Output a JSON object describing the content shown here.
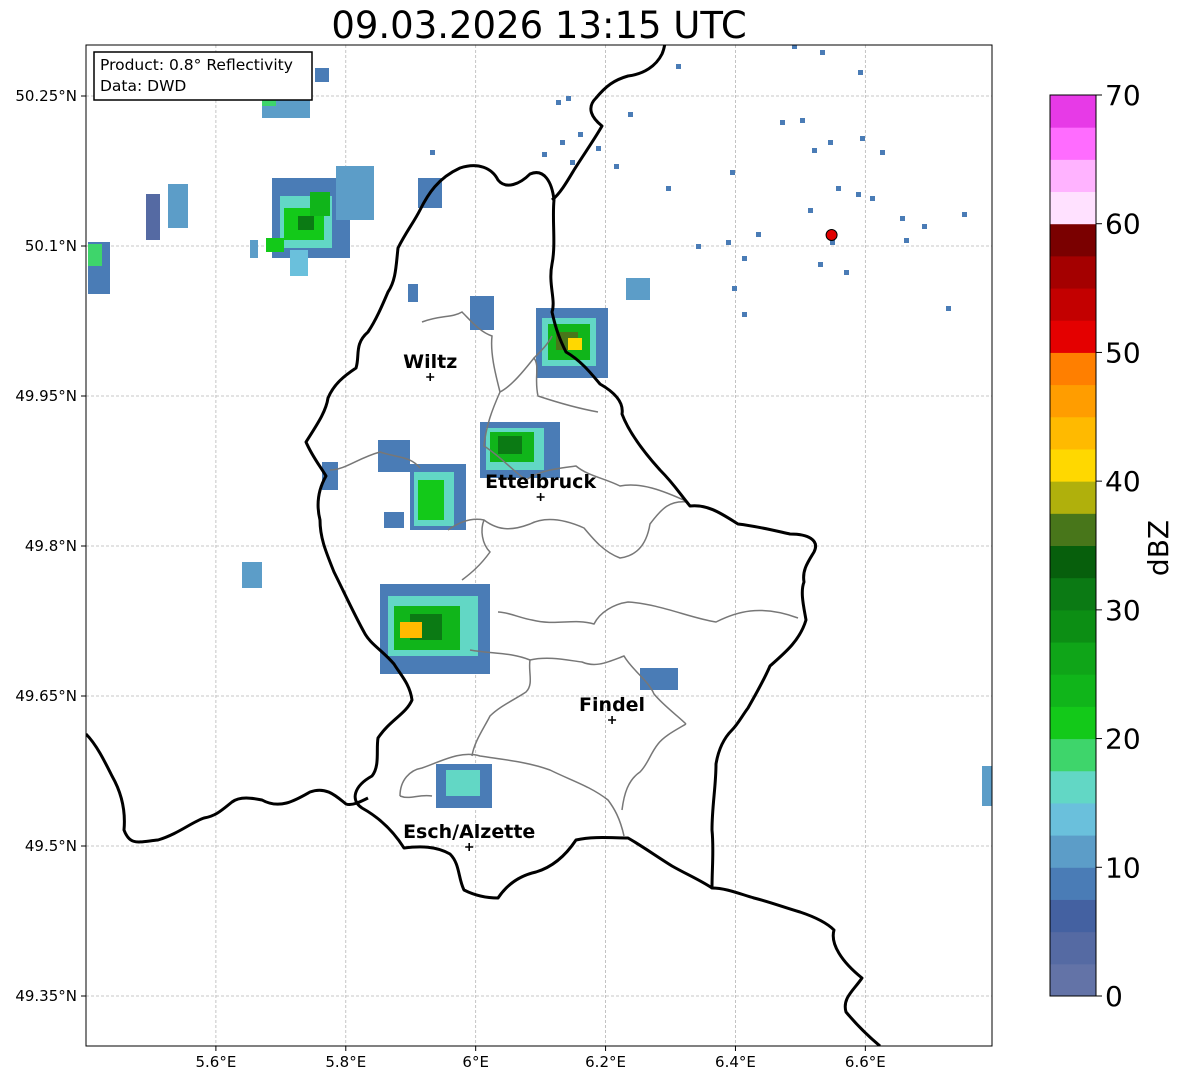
{
  "title": "09.03.2026 13:15 UTC",
  "info_box": {
    "line1": "Product: 0.8° Reflectivity",
    "line2": "Data: DWD"
  },
  "lat_labels": [
    {
      "text": "50.25°N",
      "lat": 50.25
    },
    {
      "text": "50.1°N",
      "lat": 50.1
    },
    {
      "text": "49.95°N",
      "lat": 49.95
    },
    {
      "text": "49.8°N",
      "lat": 49.8
    },
    {
      "text": "49.65°N",
      "lat": 49.65
    },
    {
      "text": "49.5°N",
      "lat": 49.5
    },
    {
      "text": "49.35°N",
      "lat": 49.35
    }
  ],
  "lon_labels": [
    {
      "text": "5.6°E",
      "lon": 5.6
    },
    {
      "text": "5.8°E",
      "lon": 5.8
    },
    {
      "text": "6°E",
      "lon": 6.0
    },
    {
      "text": "6.2°E",
      "lon": 6.2
    },
    {
      "text": "6.4°E",
      "lon": 6.4
    },
    {
      "text": "6.6°E",
      "lon": 6.6
    }
  ],
  "extent": {
    "lon_min": 5.4,
    "lon_max": 6.795,
    "lat_min": 49.3,
    "lat_max": 50.301
  },
  "cities": [
    {
      "name": "Wiltz",
      "lon": 5.93,
      "lat": 49.969
    },
    {
      "name": "Ettelbruck",
      "lon": 6.1,
      "lat": 49.849
    },
    {
      "name": "Findel",
      "lon": 6.21,
      "lat": 49.626
    },
    {
      "name": "Esch/Alzette",
      "lon": 5.99,
      "lat": 49.499
    }
  ],
  "radar_site": {
    "lon": 6.548,
    "lat": 50.111,
    "color": "#e00000"
  },
  "colorbar": {
    "label": "dBZ",
    "ticks": [
      "0",
      "10",
      "20",
      "30",
      "40",
      "50",
      "60",
      "70"
    ],
    "colors": [
      "#6373a7",
      "#556aa3",
      "#4461a1",
      "#4a7cb6",
      "#5c9dc8",
      "#6ac0dc",
      "#62d7c5",
      "#3ed56b",
      "#13c919",
      "#10b51a",
      "#0fa518",
      "#0c8e14",
      "#0b7a14",
      "#075f0c",
      "#48761a",
      "#b0b00c",
      "#ffd800",
      "#ffba00",
      "#ff9d00",
      "#ff7f00",
      "#e40000",
      "#c30000",
      "#a40000",
      "#7a0000",
      "#ffe1ff",
      "#ffb3ff",
      "#ff6cff",
      "#e73ae7"
    ]
  },
  "map_colors": {
    "border": "#000000",
    "canton": "#777777",
    "grid": "#b5b5b5"
  }
}
